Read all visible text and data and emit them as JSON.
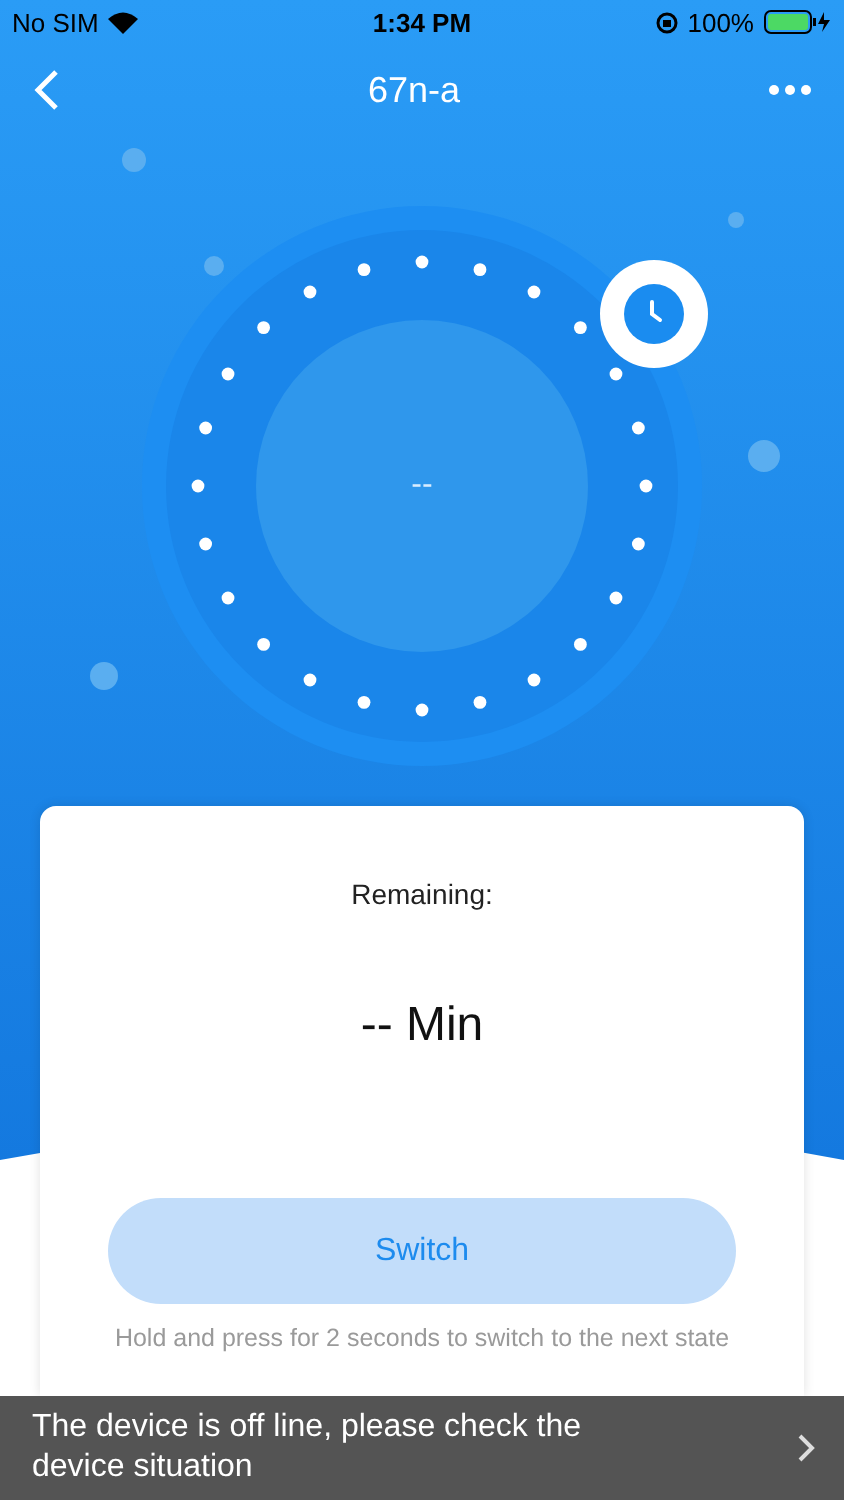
{
  "status_bar": {
    "carrier": "No SIM",
    "time": "1:34 PM",
    "battery": "100%"
  },
  "nav": {
    "title": "67n-a"
  },
  "dial": {
    "reading": "--"
  },
  "card": {
    "label": "Remaining:",
    "value": "-- Min",
    "button": "Switch",
    "hint": "Hold and press for 2 seconds to switch to the next state"
  },
  "banner": {
    "message": "The device is off line, please check the device situation"
  }
}
